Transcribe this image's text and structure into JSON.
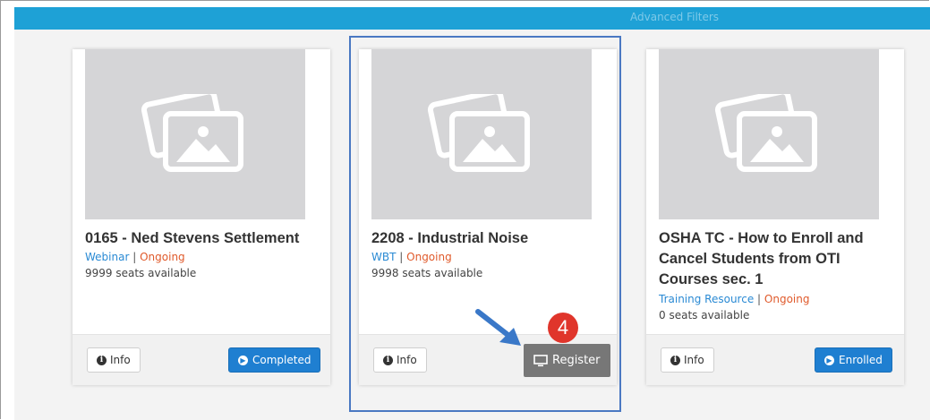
{
  "filter_bar": {
    "label": "Advanced Filters"
  },
  "courses": [
    {
      "title": "0165 - Ned Stevens Settlement",
      "type": "Webinar",
      "separator": "|",
      "status": "Ongoing",
      "seats": "9999 seats available",
      "info_label": "Info",
      "action_label": "Completed",
      "action_icon": "circle-arrow-icon"
    },
    {
      "title": "2208 - Industrial Noise",
      "type": "WBT",
      "separator": "|",
      "status": "Ongoing",
      "seats": "9998 seats available",
      "info_label": "Info",
      "action_label": "Register",
      "action_icon": "monitor-icon"
    },
    {
      "title": "OSHA TC - How to Enroll and Cancel Students from OTI Courses sec. 1",
      "type": "Training Resource",
      "separator": "|",
      "status": "Ongoing",
      "seats": "0 seats available",
      "info_label": "Info",
      "action_label": "Enrolled",
      "action_icon": "circle-arrow-icon"
    }
  ],
  "annotation": {
    "step_number": "4"
  },
  "colors": {
    "filter_bar": "#1ea1d6",
    "primary_button": "#1f7fd1",
    "register_button": "#777777",
    "type_link": "#2a8ad4",
    "status_ongoing": "#e05a2b",
    "highlight_border": "#4a78c2",
    "step_badge": "#e0352b"
  }
}
